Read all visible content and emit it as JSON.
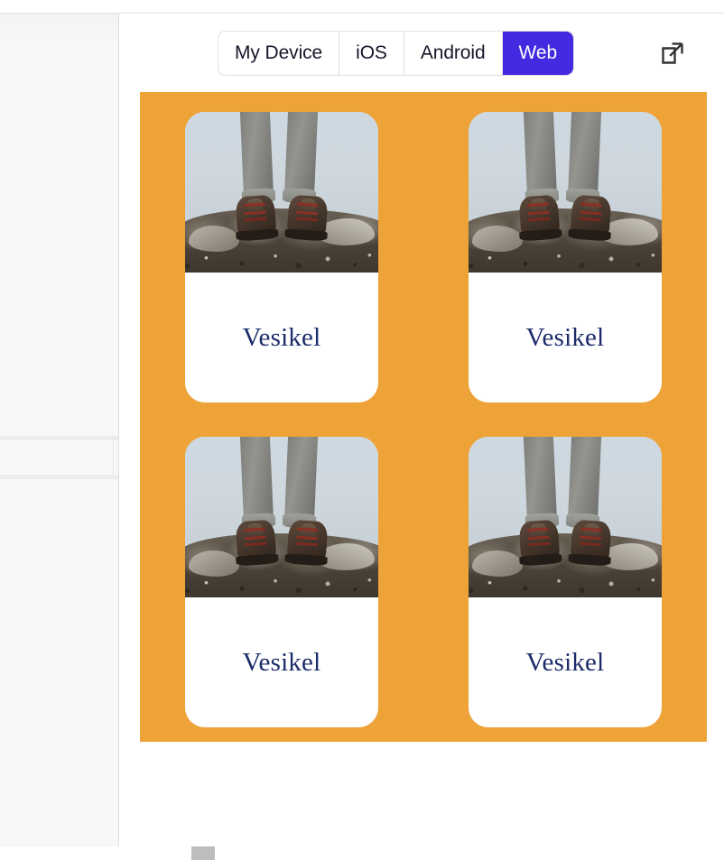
{
  "toolbar": {
    "platform_switcher": {
      "name": "platform-segmented-control",
      "options": [
        {
          "id": "my-device",
          "label": "My Device",
          "active": false
        },
        {
          "id": "ios",
          "label": "iOS",
          "active": false
        },
        {
          "id": "android",
          "label": "Android",
          "active": false
        },
        {
          "id": "web",
          "label": "Web",
          "active": true
        }
      ],
      "selected": "Web",
      "active_background": "#4329E0",
      "active_text_color": "#FFFFFF",
      "inactive_text_color": "#16162A",
      "border_color": "#E0E0E2"
    },
    "open_external": {
      "icon": "external-link-icon",
      "label": "Open preview in new window",
      "color": "#333333"
    }
  },
  "preview": {
    "canvas_background": "#EDA338",
    "card_background": "#FFFFFF",
    "card_title_color": "#1C2B6B",
    "columns": 2,
    "rows": 2,
    "cards": [
      {
        "title": "Vesikel",
        "image_alt": "Hiking boots standing on a rocky summit in fog"
      },
      {
        "title": "Vesikel",
        "image_alt": "Hiking boots standing on a rocky summit in fog"
      },
      {
        "title": "Vesikel",
        "image_alt": "Hiking boots standing on a rocky summit in fog"
      },
      {
        "title": "Vesikel",
        "image_alt": "Hiking boots standing on a rocky summit in fog"
      }
    ]
  },
  "left_panel": {
    "background": "#F7F7F7",
    "divider_color": "#DDDEE3",
    "scrollbar_color": "#BDBDBD"
  }
}
